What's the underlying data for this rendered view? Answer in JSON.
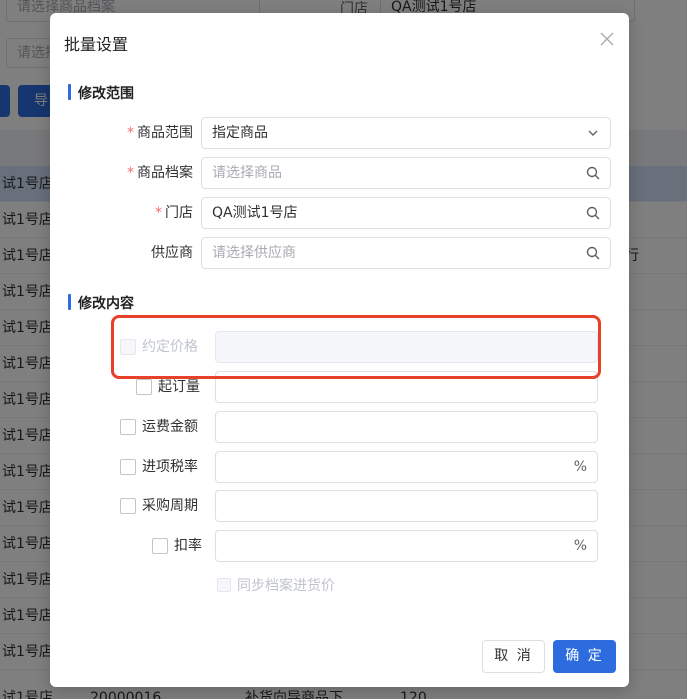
{
  "background": {
    "filter1_placeholder": "请选择商品档案",
    "filter_store_label": "门店",
    "filter_store_tag": "QA测试1号店",
    "filter2_placeholder": "请选择",
    "btn_left_label": "导",
    "rows": [
      {
        "store": "试1号店"
      },
      {
        "store": "试1号店"
      },
      {
        "store": "试1号店"
      },
      {
        "store": "试1号店"
      },
      {
        "store": "试1号店"
      },
      {
        "store": "试1号店"
      },
      {
        "store": "试1号店"
      },
      {
        "store": "试1号店"
      },
      {
        "store": "试1号店"
      },
      {
        "store": "试1号店"
      },
      {
        "store": "试1号店"
      },
      {
        "store": "试1号店"
      },
      {
        "store": "试1号店"
      },
      {
        "store": "试1号店"
      }
    ],
    "right_edge_text": "行",
    "last_row": {
      "store": "试1号店",
      "code": "20000016",
      "status": "补货向导商品下",
      "qty": "120"
    }
  },
  "dialog": {
    "title": "批量设置",
    "section_range": "修改范围",
    "section_content": "修改内容",
    "product_scope": {
      "label": "商品范围",
      "value": "指定商品"
    },
    "product_file": {
      "label": "商品档案",
      "placeholder": "请选择商品"
    },
    "store": {
      "label": "门店",
      "value": "QA测试1号店"
    },
    "supplier": {
      "label": "供应商",
      "placeholder": "请选择供应商"
    },
    "agreed_price": {
      "label": "约定价格"
    },
    "min_order": {
      "label": "起订量"
    },
    "freight": {
      "label": "运费金额"
    },
    "input_tax": {
      "label": "进项税率",
      "unit": "%"
    },
    "purchase_cycle": {
      "label": "采购周期"
    },
    "discount": {
      "label": "扣率",
      "unit": "%"
    },
    "sync_price": {
      "label": "同步档案进货价"
    },
    "cancel": "取 消",
    "confirm": "确 定"
  }
}
